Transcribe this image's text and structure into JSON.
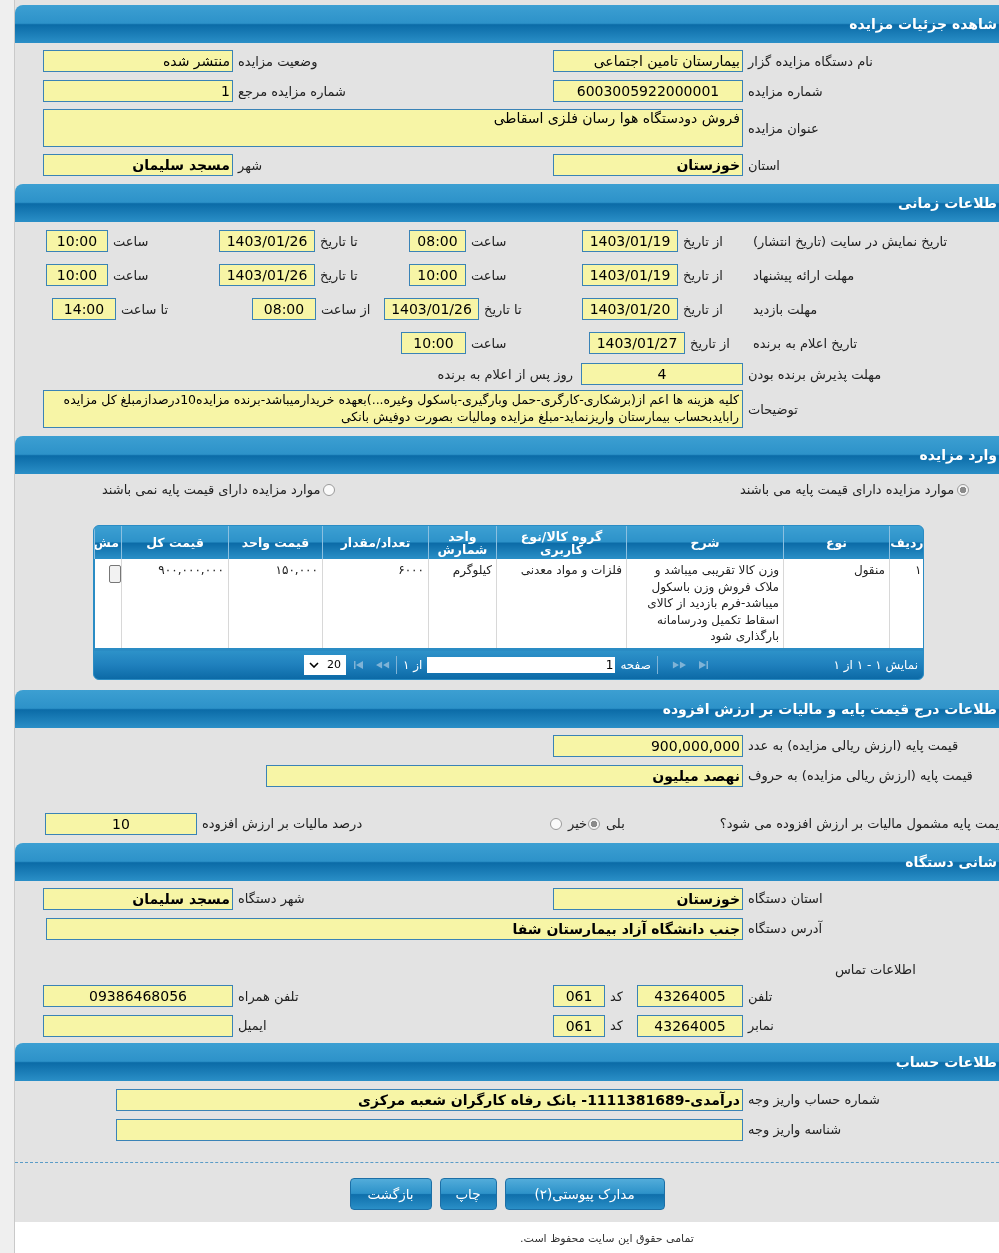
{
  "details": {
    "title": "شاهده جزئیات مزایده",
    "organizer": {
      "label": "نام دستگاه مزایده گزار",
      "value": "بیمارستان تامین اجتماعی"
    },
    "status": {
      "label": "وضعیت مزایده",
      "value": "منتشر شده"
    },
    "auction_number": {
      "label": "شماره مزایده",
      "value": "6003005922000001"
    },
    "reference_number": {
      "label": "شماره مزایده مرجع",
      "value": "1"
    },
    "subject": {
      "label": "عنوان مزایده",
      "value": "فروش دودستگاه هوا رسان فلزی اسقاطی"
    },
    "province": {
      "label": "استان",
      "value": "خوزستان"
    },
    "city": {
      "label": "شهر",
      "value": "مسجد سلیمان"
    }
  },
  "schedule": {
    "title": "طلاعات زمانی",
    "rows": [
      {
        "label": "تاریخ نمایش در سایت (تاریخ انتشار)",
        "parts": [
          {
            "label": "از تاریخ",
            "value": "1403/01/19"
          },
          {
            "label": "ساعت",
            "value": "08:00"
          },
          {
            "label": "تا تاریخ",
            "value": "1403/01/26"
          },
          {
            "label": "ساعت",
            "value": "10:00"
          }
        ]
      },
      {
        "label": "مهلت ارائه پیشنهاد",
        "parts": [
          {
            "label": "از تاریخ",
            "value": "1403/01/19"
          },
          {
            "label": "ساعت",
            "value": "10:00"
          },
          {
            "label": "تا تاریخ",
            "value": "1403/01/26"
          },
          {
            "label": "ساعت",
            "value": "10:00"
          }
        ]
      },
      {
        "label": "مهلت بازدید",
        "parts": [
          {
            "label": "از تاریخ",
            "value": "1403/01/20"
          },
          {
            "label": "تا تاریخ",
            "value": "1403/01/26"
          },
          {
            "label": "از ساعت",
            "value": "08:00"
          },
          {
            "label": "تا ساعت",
            "value": "14:00"
          }
        ]
      },
      {
        "label": "تاریخ اعلام به برنده",
        "parts": [
          {
            "label": "از تاریخ",
            "value": "1403/01/27"
          },
          {
            "label": "ساعت",
            "value": "10:00"
          }
        ]
      }
    ],
    "acceptance": {
      "label": "مهلت پذیرش برنده بودن",
      "value": "4",
      "suffix": "روز پس از اعلام به برنده"
    },
    "notes": {
      "label": "توضیحات",
      "value": "کلیه هزینه ها اعم از(برشکاری-کارگری-حمل وبارگیری-باسکول وغیره...)بعهده خریدارمیباشد-برنده مزایده10درصدازمبلغ کل مزایده رابایدبحساب بیمارستان واریزنماید-مبلغ مزایده ومالیات بصورت دوفیش بانکی"
    }
  },
  "items": {
    "title": "وارد مزایده",
    "options": [
      {
        "label": "موارد مزایده دارای قیمت پایه می باشند",
        "selected": true
      },
      {
        "label": "موارد مزایده دارای قیمت پایه نمی باشند",
        "selected": false
      }
    ],
    "table": {
      "columns": [
        "ردیف",
        "نوع",
        "شرح",
        "گروه کالا/نوع کاربری",
        "واحد شمارش",
        "تعداد/مقدار",
        "قیمت واحد",
        "قیمت کل",
        "مش"
      ],
      "rows": [
        [
          "۱",
          "منقول",
          "وزن کالا تقریبی میباشد و ملاک فروش وزن باسکول میباشد-فرم بازدید از کالای اسقاط تکمیل ودرسامانه بارگذاری شود",
          "فلزات و مواد معدنی",
          "کیلوگرم",
          "۶۰۰۰",
          "۱۵۰,۰۰۰",
          "۹۰۰,۰۰۰,۰۰۰"
        ]
      ]
    },
    "pager": {
      "summary": "نمایش ۱ - ۱ از ۱",
      "page_label": "صفحه",
      "page": "1",
      "of_label": "از ۱",
      "page_size": "20"
    }
  },
  "pricing": {
    "title": "طلاعات درج قیمت پایه و مالیات بر ارزش افزوده",
    "base_number": {
      "label": "قیمت پایه (ارزش ریالی مزایده) به عدد",
      "value": "900,000,000"
    },
    "base_words": {
      "label": "قیمت پایه (ارزش ریالی مزایده) به حروف",
      "value": "نهصد میلیون"
    },
    "vat_question": {
      "label": "یمت پایه مشمول مالیات بر ارزش افزوده می شود؟",
      "options": [
        {
          "label": "بلی",
          "selected": true
        },
        {
          "label": "خیر",
          "selected": false
        }
      ]
    },
    "vat_percent": {
      "label": "درصد مالیات بر ارزش افزوده",
      "value": "10"
    }
  },
  "organization": {
    "title": "شانی دستگاه",
    "province": {
      "label": "استان دستگاه",
      "value": "خوزستان"
    },
    "city": {
      "label": "شهر دستگاه",
      "value": "مسجد سلیمان"
    },
    "address": {
      "label": "آدرس دستگاه",
      "value": "جنب دانشگاه آزاد بیمارستان شفا"
    },
    "contact_heading": "اطلاعات تماس",
    "phone": {
      "label": "تلفن",
      "value": "43264005",
      "code_label": "کد",
      "code": "061"
    },
    "mobile": {
      "label": "تلفن همراه",
      "value": "09386468056"
    },
    "fax": {
      "label": "نمابر",
      "value": "43264005",
      "code_label": "کد",
      "code": "061"
    },
    "email": {
      "label": "ایمیل"
    }
  },
  "account": {
    "title": "طلاعات حساب",
    "account_number": {
      "label": "شماره حساب واریز وجه",
      "value": "درآمدی-1111381689- بانک رفاه کارگران شعبه مرکزی"
    },
    "payment_id": {
      "label": "شناسه واریز وجه"
    }
  },
  "buttons": [
    "مدارک پیوستی(۲)",
    "چاپ",
    "بازگشت"
  ],
  "footer": "تمامی حقوق این سایت محفوظ است."
}
